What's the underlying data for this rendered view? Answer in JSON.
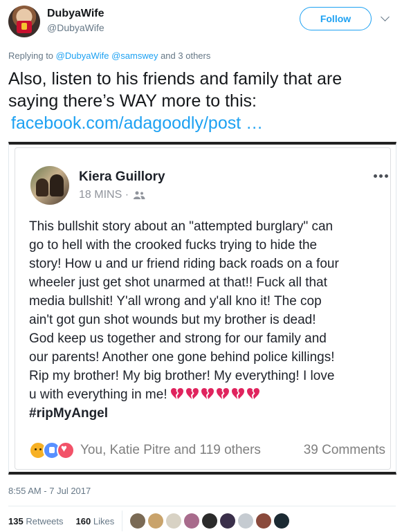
{
  "header": {
    "display_name": "DubyaWife",
    "handle": "@DubyaWife",
    "follow_label": "Follow"
  },
  "replying": {
    "prefix": "Replying to",
    "user1": "@DubyaWife",
    "user2": "@samswey",
    "suffix": "and 3 others"
  },
  "tweet": {
    "line1": "Also, listen to his friends and family that are",
    "line2": "saying there’s WAY more to this:",
    "link": "facebook.com/adagoodly/post …"
  },
  "fb_post": {
    "name": "Kiera Guillory",
    "time": "18 MINS ·",
    "body_lines": [
      "This bullshit story about an \"attempted burglary\" can",
      "go to hell with the crooked fucks trying to hide the",
      "story! How u and ur friend riding back roads on a four",
      "wheeler just get shot unarmed at that!! Fuck all that",
      "media bullshit! Y'all wrong and y'all kno it! The cop",
      "ain't got gun shot wounds but my brother is dead!",
      "God keep us together and strong for our family and",
      "our parents! Another one gone behind police killings!",
      "Rip my brother! My big brother! My everything! I love",
      "u with everything in me!"
    ],
    "hashtag": "#ripMyAngel",
    "reaction_names": "You, Katie Pitre and 119 others",
    "comments": "39 Comments",
    "heart_count": 6,
    "icons": [
      "friends-icon",
      "more-options-icon",
      "sad-reaction-icon",
      "like-reaction-icon",
      "love-reaction-icon",
      "broken-heart-icon"
    ]
  },
  "footer": {
    "timestamp": "8:55 AM - 7 Jul 2017",
    "retweets_count": "135",
    "retweets_label": "Retweets",
    "likes_count": "160",
    "likes_label": "Likes"
  },
  "colors": {
    "accent": "#1da1f2",
    "muted": "#657786",
    "broken_heart": "#e0245e"
  }
}
